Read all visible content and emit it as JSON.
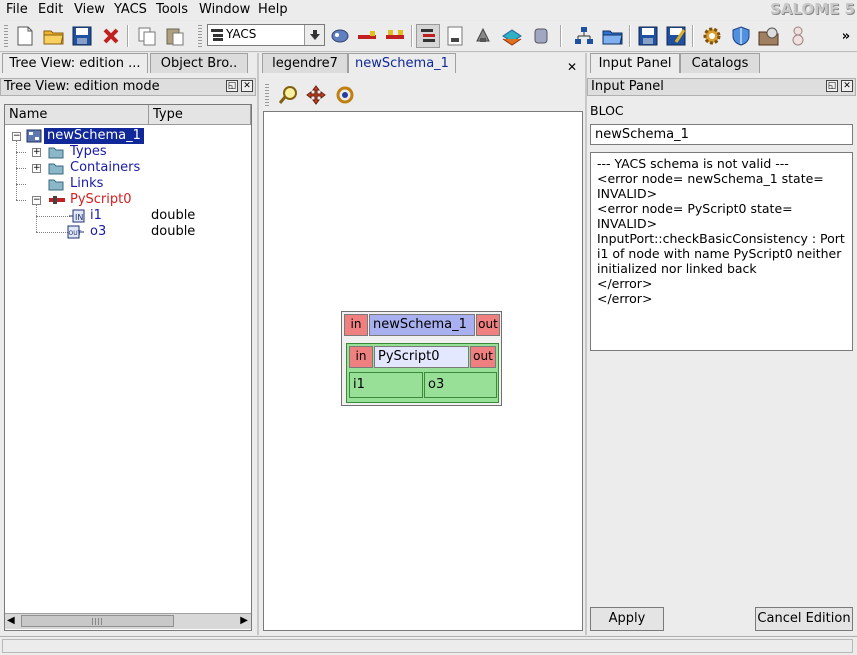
{
  "menubar": {
    "items": [
      "File",
      "Edit",
      "View",
      "YACS",
      "Tools",
      "Window",
      "Help"
    ],
    "logo": "SALOME 5"
  },
  "toolbar": {
    "module_combo": "YACS",
    "icons": [
      "new-document-icon",
      "open-folder-icon",
      "save-icon",
      "close-icon",
      "copy-icon",
      "paste-icon",
      "module-selector-icon",
      "arrange-icon",
      "line-icon",
      "line-arrow-icon",
      "tree-view-icon",
      "python-node-icon",
      "service-node-icon",
      "catalog-icon",
      "container-icon",
      "schema-tree-icon",
      "open-schema-icon",
      "save-schema-icon",
      "edit-schema-icon",
      "settings-gear-icon",
      "shield-icon",
      "load-icon",
      "snowman-icon",
      "overflow-chevron-icon"
    ]
  },
  "left_panel": {
    "tabs": [
      "Tree View: edition ...",
      "Object Bro.."
    ],
    "title": "Tree View: edition mode",
    "columns": [
      "Name",
      "Type"
    ],
    "tree": [
      {
        "label": "newSchema_1",
        "type": "",
        "color": "#ffffff",
        "selected": true
      },
      {
        "label": "Types",
        "type": "",
        "color": "#1a1aa6"
      },
      {
        "label": "Containers",
        "type": "",
        "color": "#1a1aa6"
      },
      {
        "label": "Links",
        "type": "",
        "color": "#1a1aa6"
      },
      {
        "label": "PyScript0",
        "type": "",
        "color": "#d42020"
      },
      {
        "label": "i1",
        "type": "double",
        "color": "#1a1aa6"
      },
      {
        "label": "o3",
        "type": "double",
        "color": "#1a1aa6"
      }
    ]
  },
  "center_panel": {
    "tabs": [
      "legendre7",
      "newSchema_1"
    ],
    "close_glyph": "✕",
    "schema": {
      "name": "newSchema_1",
      "in_label": "in",
      "out_label": "out",
      "node": {
        "name": "PyScript0",
        "in_label": "in",
        "out_label": "out",
        "input_port": "i1",
        "output_port": "o3"
      }
    },
    "colors": {
      "schema_header": "#a8b0f0",
      "node_body": "#98e098",
      "port": "#f08080"
    }
  },
  "right_panel": {
    "tabs": [
      "Input Panel",
      "Catalogs"
    ],
    "title": "Input Panel",
    "kind": "BLOC",
    "name_value": "newSchema_1",
    "messages": [
      "--- YACS schema is not valid ---",
      "",
      "<error node= newSchema_1 state= INVALID>",
      "<error node= PyScript0 state= INVALID>",
      "InputPort::checkBasicConsistency : Port i1 of node with name PyScript0 neither initialized nor linked back",
      "</error>",
      "</error>"
    ],
    "apply_label": "Apply",
    "cancel_label": "Cancel Edition"
  }
}
